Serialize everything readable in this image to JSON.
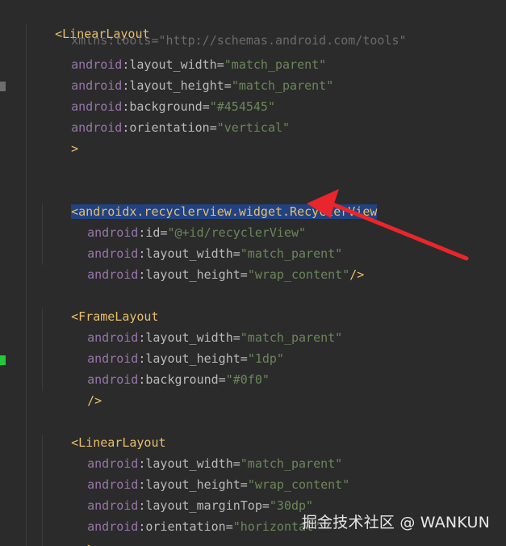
{
  "lines": {
    "l1": {
      "open": "<",
      "tag": "LinearLayout"
    },
    "l2": {
      "text": "xmlns:tools=\"http://schemas.android.com/tools\""
    },
    "l3": {
      "ns": "android",
      "colon": ":",
      "attr": "layout_width",
      "eq": "=",
      "value": "\"match_parent\""
    },
    "l4": {
      "ns": "android",
      "colon": ":",
      "attr": "layout_height",
      "eq": "=",
      "value": "\"match_parent\""
    },
    "l5": {
      "ns": "android",
      "colon": ":",
      "attr": "background",
      "eq": "=",
      "value": "\"#454545\""
    },
    "l6": {
      "ns": "android",
      "colon": ":",
      "attr": "orientation",
      "eq": "=",
      "value": "\"vertical\""
    },
    "l7": {
      "close": ">"
    },
    "l8": {
      "open": "<",
      "tag": "androidx.recyclerview.widget.RecyclerView"
    },
    "l9": {
      "ns": "android",
      "colon": ":",
      "attr": "id",
      "eq": "=",
      "value": "\"@+id/recyclerView\""
    },
    "l10": {
      "ns": "android",
      "colon": ":",
      "attr": "layout_width",
      "eq": "=",
      "value": "\"match_parent\""
    },
    "l11": {
      "ns": "android",
      "colon": ":",
      "attr": "layout_height",
      "eq": "=",
      "value": "\"wrap_content\"",
      "close": "/>"
    },
    "l12": {
      "open": "<",
      "tag": "FrameLayout"
    },
    "l13": {
      "ns": "android",
      "colon": ":",
      "attr": "layout_width",
      "eq": "=",
      "value": "\"match_parent\""
    },
    "l14": {
      "ns": "android",
      "colon": ":",
      "attr": "layout_height",
      "eq": "=",
      "value": "\"1dp\""
    },
    "l15": {
      "ns": "android",
      "colon": ":",
      "attr": "background",
      "eq": "=",
      "value": "\"#0f0\""
    },
    "l16": {
      "close": "/>"
    },
    "l17": {
      "open": "<",
      "tag": "LinearLayout"
    },
    "l18": {
      "ns": "android",
      "colon": ":",
      "attr": "layout_width",
      "eq": "=",
      "value": "\"match_parent\""
    },
    "l19": {
      "ns": "android",
      "colon": ":",
      "attr": "layout_height",
      "eq": "=",
      "value": "\"wrap_content\""
    },
    "l20": {
      "ns": "android",
      "colon": ":",
      "attr": "layout_marginTop",
      "eq": "=",
      "value": "\"30dp\""
    },
    "l21": {
      "ns": "android",
      "colon": ":",
      "attr": "orientation",
      "eq": "=",
      "value": "\"horizontal\""
    },
    "l22": {
      "close": ">"
    }
  },
  "watermark": "掘金技术社区 @ WANKUN",
  "colors": {
    "background": "#2b2b2b",
    "tag": "#e8bf6a",
    "namespace": "#9876aa",
    "attribute": "#bababa",
    "string": "#6a8759",
    "selection": "#214283",
    "arrow": "#e8262b",
    "gutter_marker_gray": "#6e6e6e",
    "gutter_marker_green": "#22c93a"
  }
}
